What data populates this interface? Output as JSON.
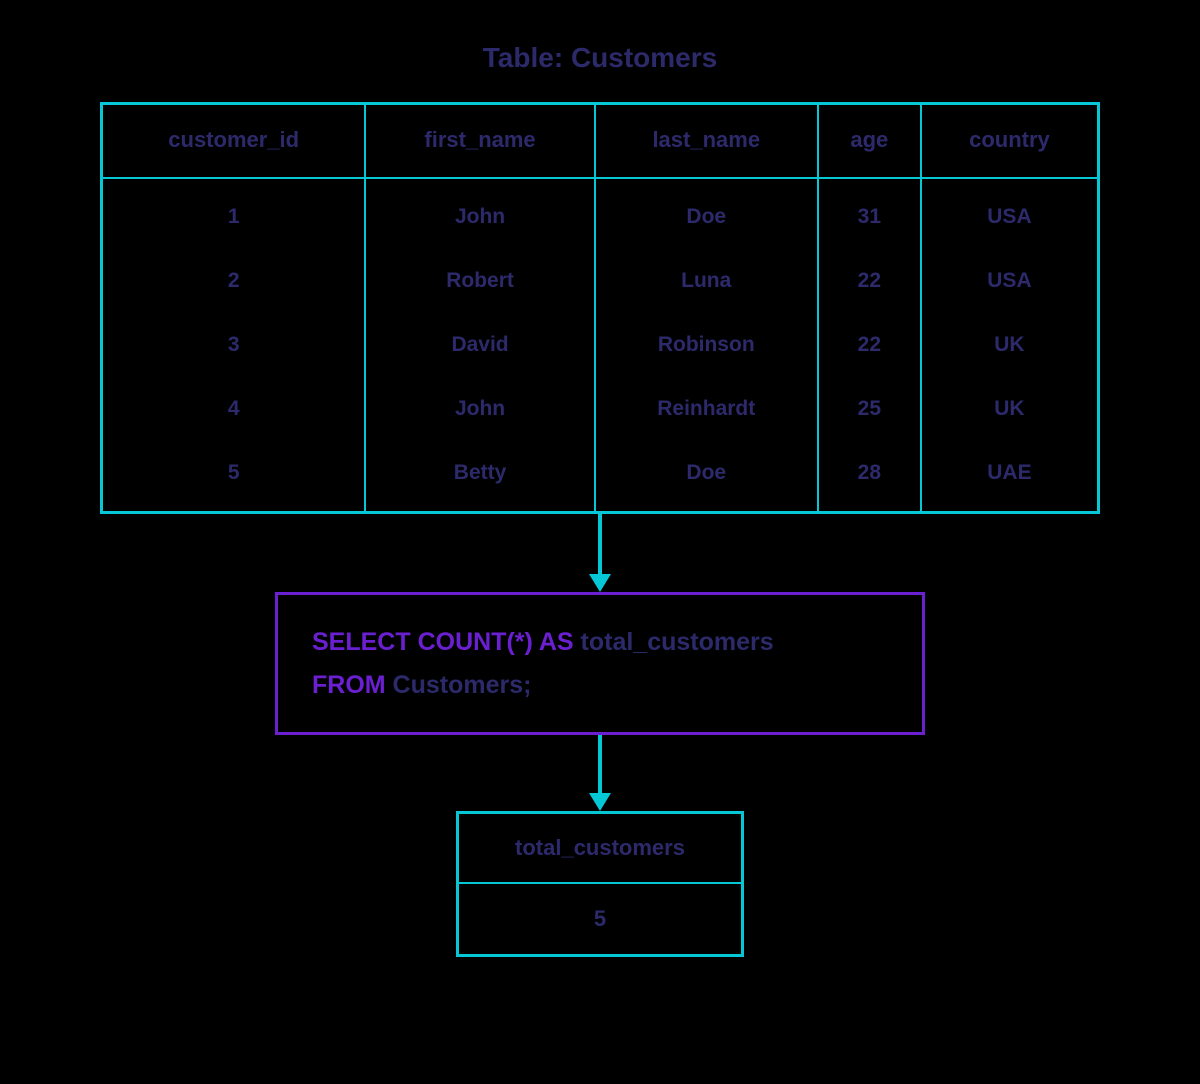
{
  "title": "Table: Customers",
  "customers": {
    "headers": [
      "customer_id",
      "first_name",
      "last_name",
      "age",
      "country"
    ],
    "rows": [
      {
        "customer_id": "1",
        "first_name": "John",
        "last_name": "Doe",
        "age": "31",
        "country": "USA"
      },
      {
        "customer_id": "2",
        "first_name": "Robert",
        "last_name": "Luna",
        "age": "22",
        "country": "USA"
      },
      {
        "customer_id": "3",
        "first_name": "David",
        "last_name": "Robinson",
        "age": "22",
        "country": "UK"
      },
      {
        "customer_id": "4",
        "first_name": "John",
        "last_name": "Reinhardt",
        "age": "25",
        "country": "UK"
      },
      {
        "customer_id": "5",
        "first_name": "Betty",
        "last_name": "Doe",
        "age": "28",
        "country": "UAE"
      }
    ]
  },
  "query": {
    "kw_select": "SELECT COUNT(*) AS",
    "alias": " total_customers",
    "kw_from": "FROM",
    "from_table": " Customers;"
  },
  "result": {
    "header": "total_customers",
    "value": "5"
  }
}
